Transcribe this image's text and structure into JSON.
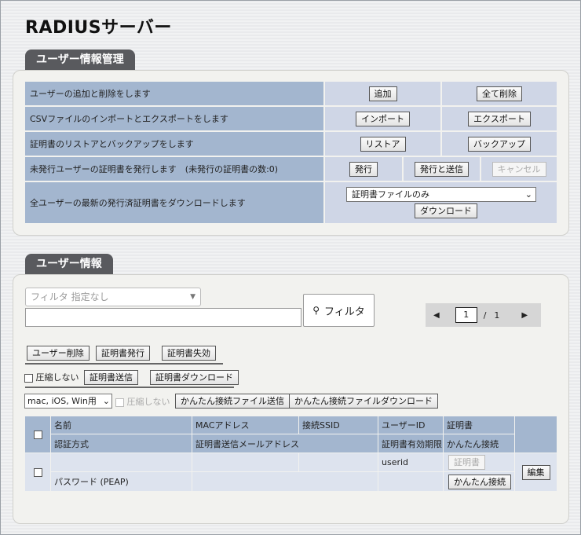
{
  "page_title": "RADIUSサーバー",
  "section1": {
    "tab": "ユーザー情報管理",
    "rows": [
      {
        "label": "ユーザーの追加と削除をします",
        "btn1": "追加",
        "btn2": "全て削除"
      },
      {
        "label": "CSVファイルのインポートとエクスポートをします",
        "btn1": "インポート",
        "btn2": "エクスポート"
      },
      {
        "label": "証明書のリストアとバックアップをします",
        "btn1": "リストア",
        "btn2": "バックアップ"
      },
      {
        "label": "未発行ユーザーの証明書を発行します　(未発行の証明書の数:0)",
        "btn1": "発行",
        "btn2": "発行と送信",
        "btn3": "キャンセル"
      },
      {
        "label": "全ユーザーの最新の発行済証明書をダウンロードします",
        "select": "証明書ファイルのみ",
        "btn1": "ダウンロード"
      }
    ]
  },
  "section2": {
    "tab": "ユーザー情報",
    "filter_placeholder": "フィルタ 指定なし",
    "filter_button": "フィルタ",
    "pager": {
      "current": "1",
      "separator": "/",
      "total": "1"
    },
    "actions1": [
      "ユーザー削除",
      "証明書発行",
      "証明書失効"
    ],
    "no_compress_label": "圧縮しない",
    "actions2": [
      "証明書送信",
      "証明書ダウンロード"
    ],
    "os_select": "mac, iOS, Win用",
    "no_compress_label2": "圧縮しない",
    "actions3": [
      "かんたん接続ファイル送信",
      "かんたん接続ファイルダウンロード"
    ],
    "table": {
      "headers_row1": [
        "名前",
        "MACアドレス",
        "接続SSID",
        "ユーザーID",
        "証明書"
      ],
      "headers_row2": [
        "認証方式",
        "証明書送信メールアドレス",
        "証明書有効期限",
        "かんたん接続"
      ],
      "row": {
        "user_id": "userid",
        "auth": "パスワード (PEAP)",
        "cert_btn": "証明書",
        "easy_btn": "かんたん接続",
        "edit_btn": "編集"
      }
    }
  },
  "colors": {
    "header_cell": "#a3b6cf",
    "cell": "#cfd6e6",
    "tab": "#595a5e"
  }
}
